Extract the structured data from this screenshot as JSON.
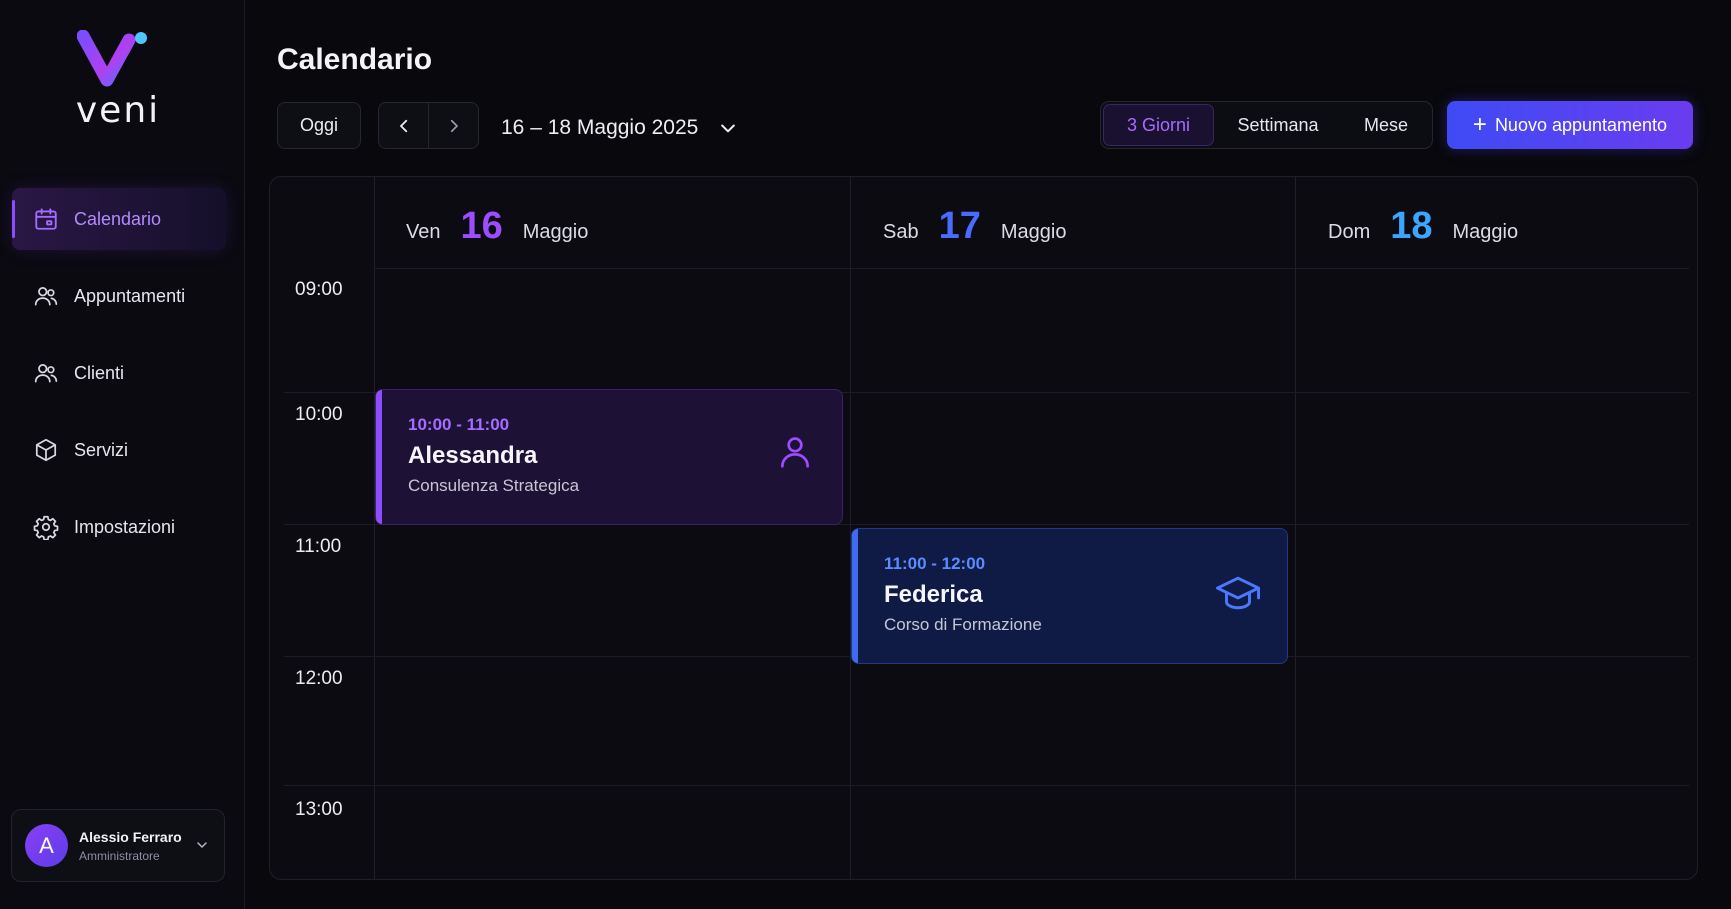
{
  "app": {
    "logo_text": "veni"
  },
  "sidebar": {
    "items": [
      {
        "label": "Calendario",
        "icon": "calendar-icon",
        "active": true
      },
      {
        "label": "Appuntamenti",
        "icon": "users-icon",
        "active": false
      },
      {
        "label": "Clienti",
        "icon": "users-icon",
        "active": false
      },
      {
        "label": "Servizi",
        "icon": "box-icon",
        "active": false
      },
      {
        "label": "Impostazioni",
        "icon": "gear-icon",
        "active": false
      }
    ]
  },
  "user": {
    "initial": "A",
    "name": "Alessio Ferraro",
    "role": "Amministratore"
  },
  "header": {
    "title": "Calendario",
    "today_label": "Oggi",
    "date_range": "16 – 18 Maggio 2025",
    "views": [
      "3 Giorni",
      "Settimana",
      "Mese"
    ],
    "active_view": "3 Giorni",
    "new_button": "Nuovo appuntamento"
  },
  "calendar": {
    "days": [
      {
        "weekday": "Ven",
        "number": "16",
        "month": "Maggio",
        "color": "#9b4dff"
      },
      {
        "weekday": "Sab",
        "number": "17",
        "month": "Maggio",
        "color": "#4a6bff"
      },
      {
        "weekday": "Dom",
        "number": "18",
        "month": "Maggio",
        "color": "#3ba6ff"
      }
    ],
    "times": [
      "09:00",
      "10:00",
      "11:00",
      "12:00",
      "13:00"
    ],
    "events": [
      {
        "time": "10:00 - 11:00",
        "name": "Alessandra",
        "service": "Consulenza Strategica",
        "icon": "user-icon",
        "day": "Ven"
      },
      {
        "time": "11:00 - 12:00",
        "name": "Federica",
        "service": "Corso di Formazione",
        "icon": "graduation-cap-icon",
        "day": "Sab"
      }
    ]
  },
  "colors": {
    "accent_purple": "#8b4dff",
    "accent_blue": "#3d6cf0",
    "background": "#08080d"
  }
}
